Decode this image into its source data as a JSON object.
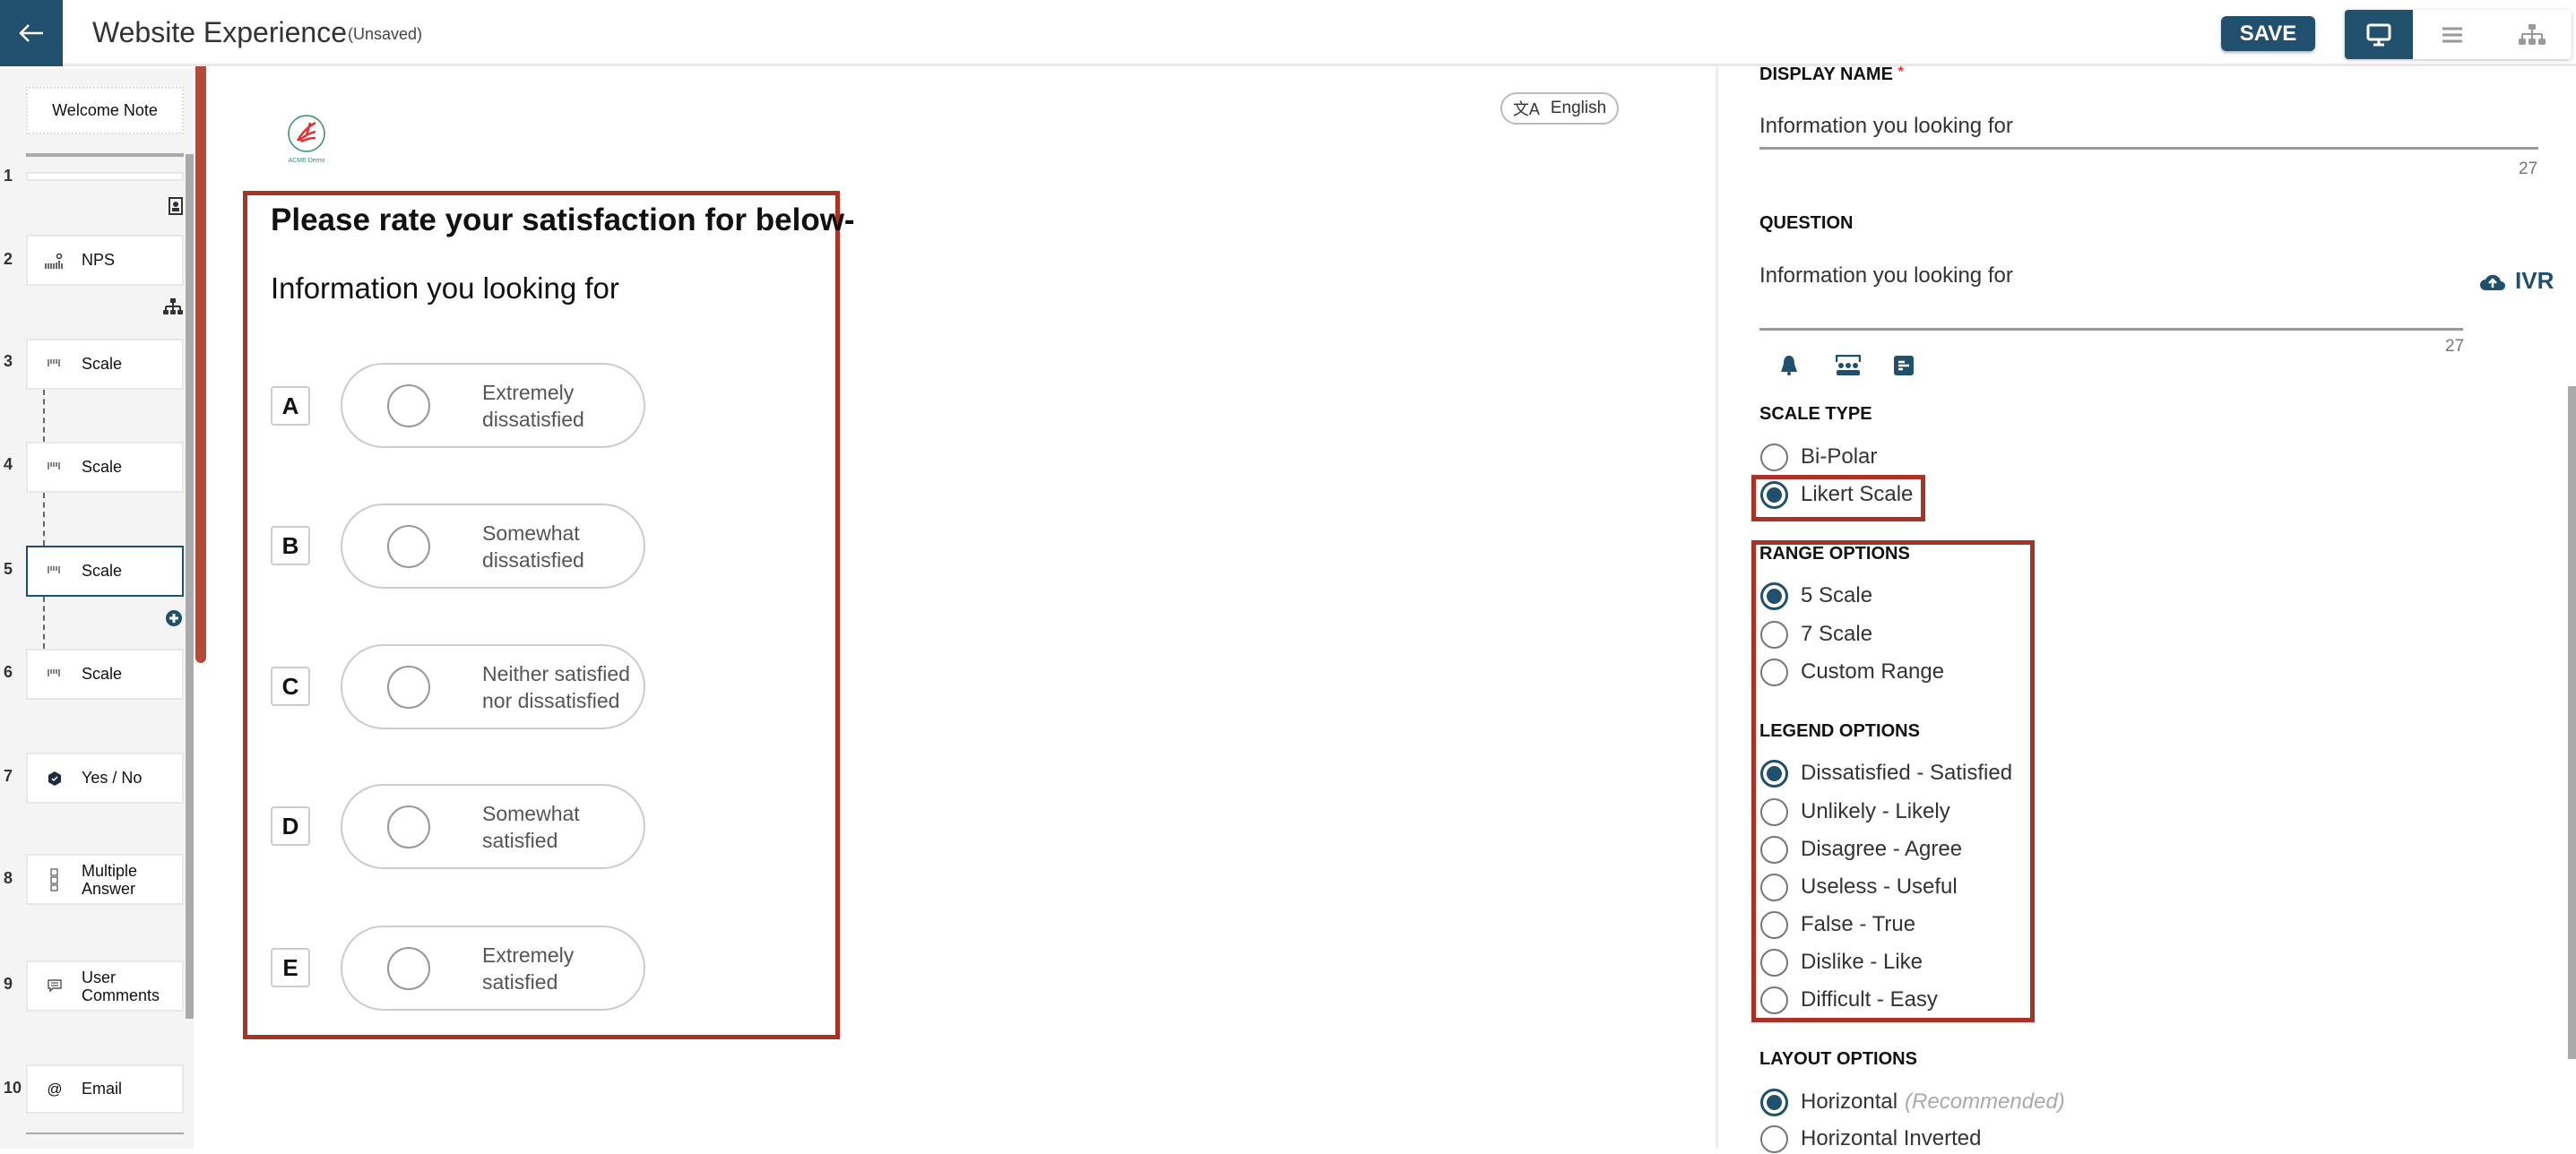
{
  "header": {
    "title": "Website Experience",
    "status": "(Unsaved)",
    "save_label": "SAVE",
    "views": [
      "desktop-icon",
      "list-icon",
      "sitemap-icon"
    ],
    "active_view": "desktop"
  },
  "sidebar": {
    "welcome": "Welcome Note",
    "items": [
      {
        "num": "1",
        "label": ""
      },
      {
        "num": "2",
        "label": "NPS",
        "icon": "nps-icon"
      },
      {
        "num": "3",
        "label": "Scale",
        "icon": "scale-icon"
      },
      {
        "num": "4",
        "label": "Scale",
        "icon": "scale-icon"
      },
      {
        "num": "5",
        "label": "Scale",
        "icon": "scale-icon",
        "selected": true
      },
      {
        "num": "6",
        "label": "Scale",
        "icon": "scale-icon"
      },
      {
        "num": "7",
        "label": "Yes / No",
        "icon": "check-badge-icon"
      },
      {
        "num": "8",
        "label": "Multiple Answer",
        "icon": "checklist-icon"
      },
      {
        "num": "9",
        "label": "User Comments",
        "icon": "comment-icon"
      },
      {
        "num": "10",
        "label": "Email",
        "icon": "at-icon"
      }
    ]
  },
  "preview": {
    "logo_text": "ACME Demo",
    "language": "English",
    "heading": "Please rate your satisfaction for below-",
    "question": "Information you looking for",
    "options": [
      {
        "letter": "A",
        "label": "Extremely dissatisfied"
      },
      {
        "letter": "B",
        "label": "Somewhat dissatisfied"
      },
      {
        "letter": "C",
        "label": "Neither satisfied nor dissatisfied"
      },
      {
        "letter": "D",
        "label": "Somewhat satisfied"
      },
      {
        "letter": "E",
        "label": "Extremely satisfied"
      }
    ]
  },
  "settings": {
    "display_name_label": "DISPLAY NAME",
    "required_mark": "*",
    "display_name_value": "Information you looking for",
    "display_name_count": "27",
    "question_label": "QUESTION",
    "question_value": "Information you looking for",
    "question_count": "27",
    "ivr_label": "IVR",
    "scale_type_label": "SCALE TYPE",
    "scale_types": [
      "Bi-Polar",
      "Likert Scale"
    ],
    "scale_type_selected": "Likert Scale",
    "range_label": "RANGE OPTIONS",
    "ranges": [
      "5 Scale",
      "7 Scale",
      "Custom Range"
    ],
    "range_selected": "5 Scale",
    "legend_label": "LEGEND OPTIONS",
    "legends": [
      "Dissatisfied - Satisfied",
      "Unlikely - Likely",
      "Disagree - Agree",
      "Useless - Useful",
      "False - True",
      "Dislike - Like",
      "Difficult - Easy"
    ],
    "legend_selected": "Dissatisfied - Satisfied",
    "layout_label": "LAYOUT OPTIONS",
    "layouts": [
      "Horizontal",
      "Horizontal Inverted"
    ],
    "layout_recommended": "(Recommended)",
    "layout_selected": "Horizontal"
  },
  "colors": {
    "brand": "#20506e",
    "highlight": "#a83223"
  }
}
